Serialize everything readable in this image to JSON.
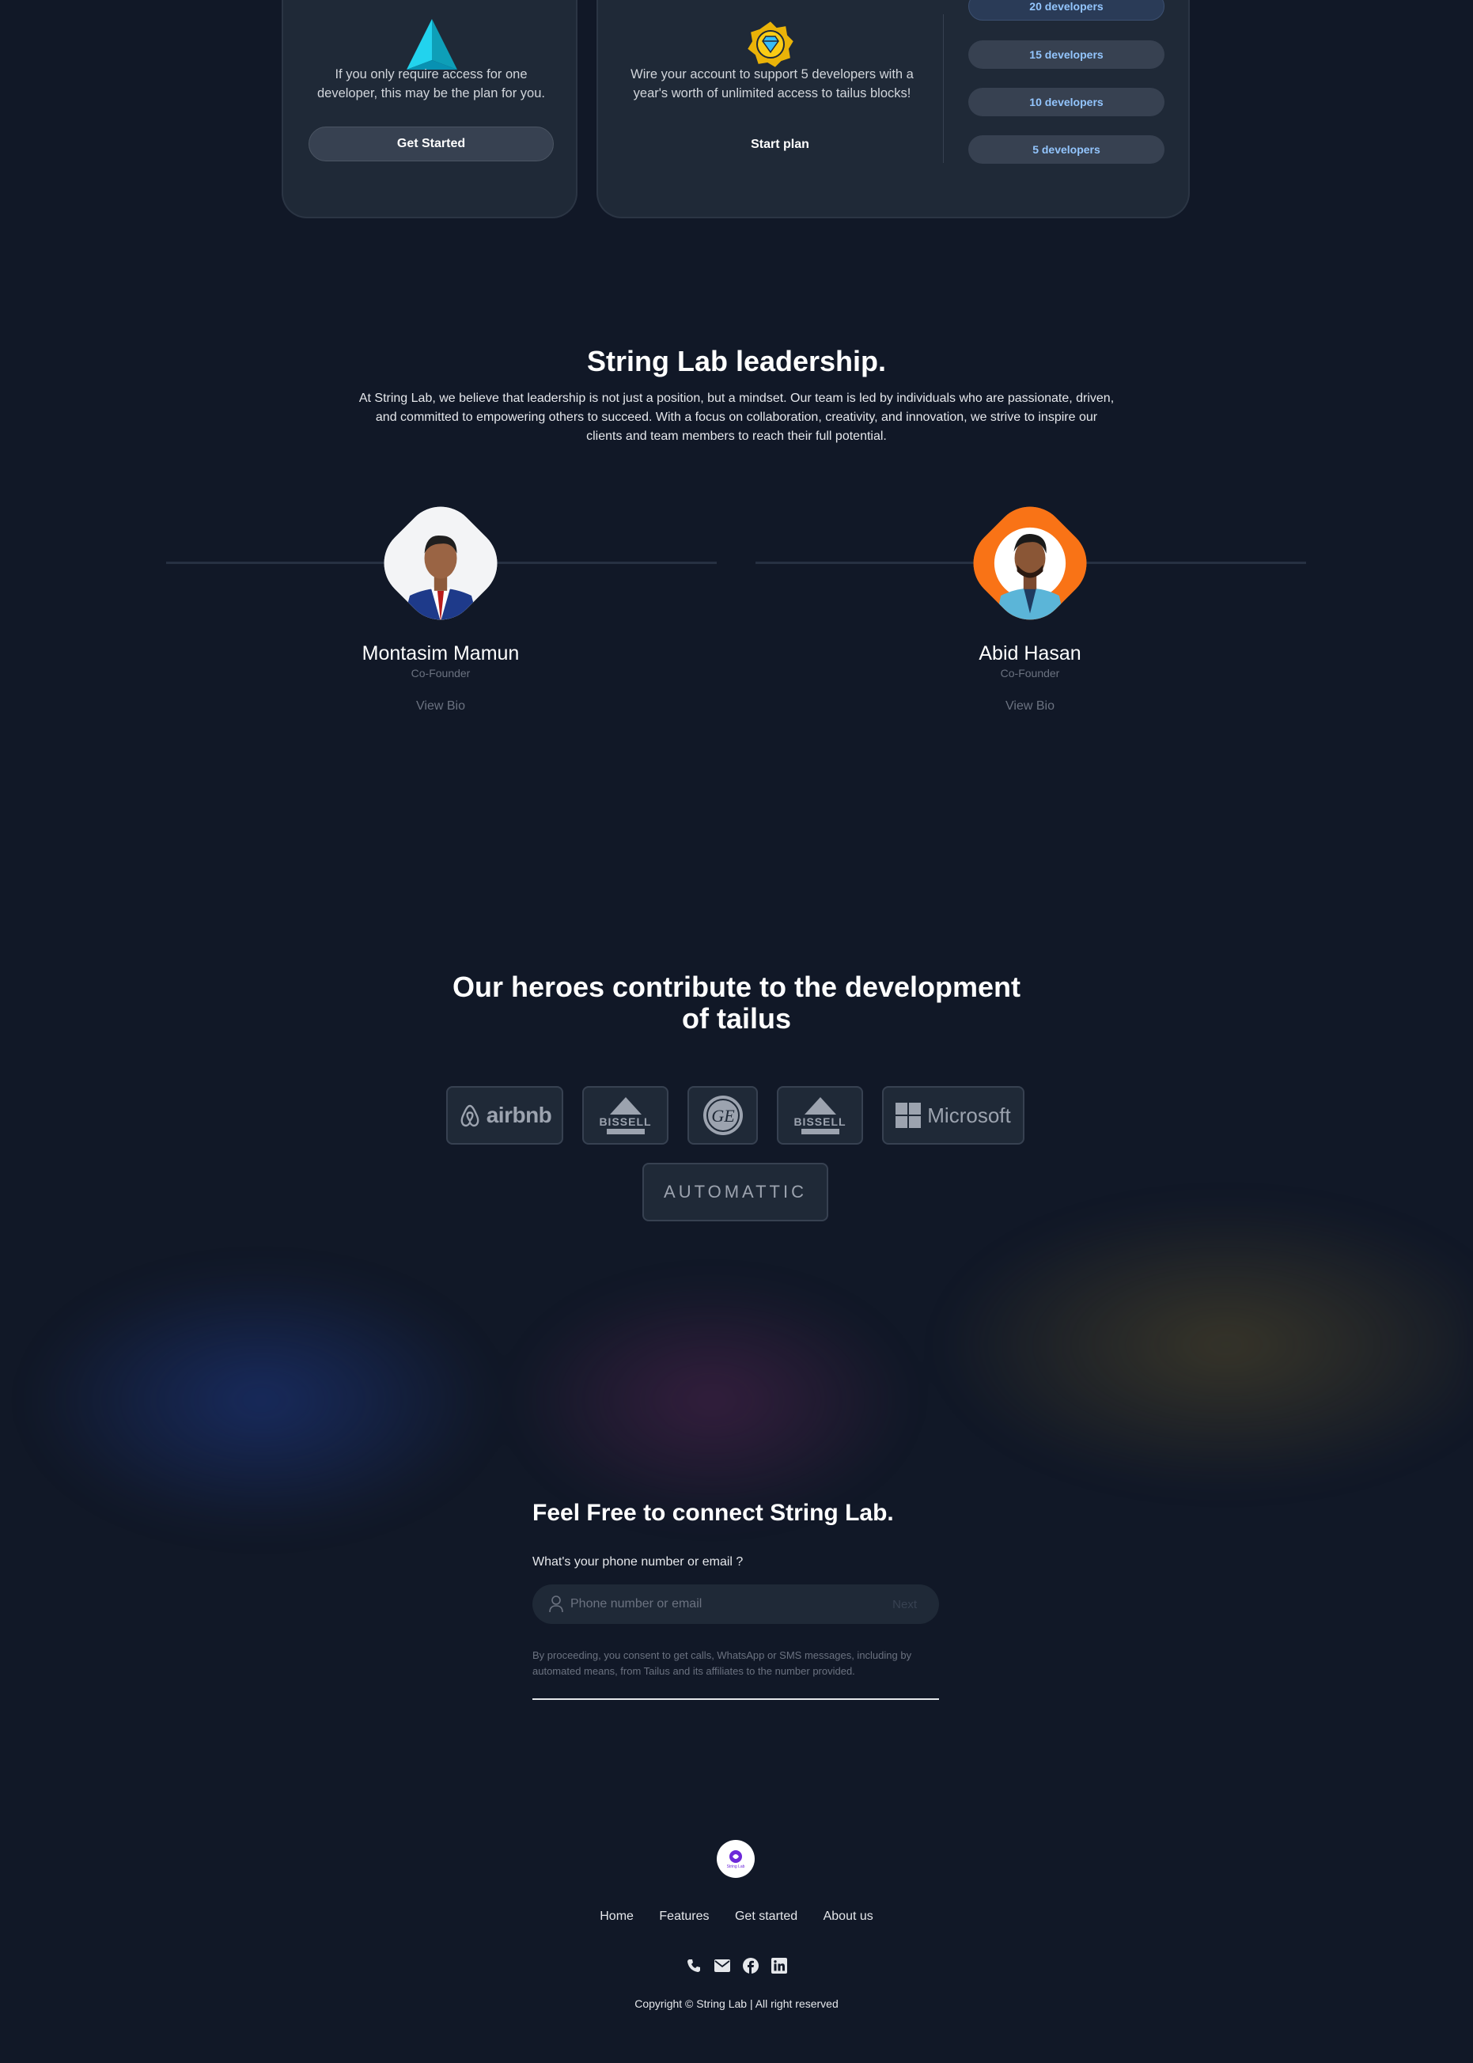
{
  "pricing": {
    "single": {
      "description_line1": "If you only require access for one",
      "description_line2": "developer, this may be the plan for you.",
      "button": "Get Started"
    },
    "team": {
      "description_line1": "Wire your account to support 5 developers with a",
      "description_line2": "year's worth of unlimited access to tailus blocks!",
      "button": "Start plan",
      "options": [
        "20 developers",
        "15 developers",
        "10 developers",
        "5 developers"
      ]
    }
  },
  "leadership": {
    "title": "String Lab leadership.",
    "paragraph_line1": "At String Lab, we believe that leadership is not just a position, but a mindset. Our team is led by individuals who are passionate, driven,",
    "paragraph_line2": "and committed to empowering others to succeed. With a focus on collaboration, creativity, and innovation, we strive to inspire our",
    "paragraph_line3": "clients and team members to reach their full potential.",
    "people": [
      {
        "name": "Montasim Mamun",
        "role": "Co-Founder",
        "link": "View Bio"
      },
      {
        "name": "Abid Hasan",
        "role": "Co-Founder",
        "link": "View Bio"
      }
    ]
  },
  "heroes": {
    "title_line1": "Our heroes contribute to the development",
    "title_line2": "of tailus",
    "logos": [
      "airbnb",
      "BISSELL",
      "GE",
      "BISSELL",
      "Microsoft",
      "AUTOMATTIC"
    ]
  },
  "contact": {
    "title": "Feel Free to connect String Lab.",
    "label": "What's your phone number or email ?",
    "placeholder": "Phone number or email",
    "next": "Next",
    "consent_line1": "By proceeding, you consent to get calls, WhatsApp or SMS messages, including by",
    "consent_line2": "automated means, from Tailus and its affiliates to the number provided."
  },
  "footer": {
    "logo_text": "String Lab",
    "nav": [
      "Home",
      "Features",
      "Get started",
      "About us"
    ],
    "socials": [
      "phone-icon",
      "mail-icon",
      "facebook-icon",
      "linkedin-icon"
    ],
    "copyright": "Copyright © String Lab | All right reserved"
  }
}
